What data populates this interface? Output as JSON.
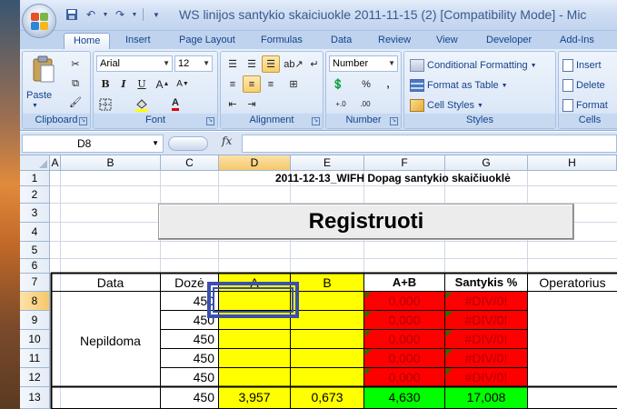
{
  "window": {
    "title": "WS linijos santykio skaiciuokle 2011-11-15 (2)  [Compatibility Mode] - Mic"
  },
  "tabs": [
    "Home",
    "Insert",
    "Page Layout",
    "Formulas",
    "Data",
    "Review",
    "View",
    "Developer",
    "Add-Ins"
  ],
  "ribbon": {
    "clipboard": {
      "label": "Clipboard",
      "paste": "Paste"
    },
    "font": {
      "label": "Font",
      "name": "Arial",
      "size": "12"
    },
    "alignment": {
      "label": "Alignment"
    },
    "number": {
      "label": "Number",
      "format": "Number",
      "percent": "%",
      "comma": ",",
      "dec_inc": "+.0",
      "dec_dec": ".00"
    },
    "styles": {
      "label": "Styles",
      "conditional": "Conditional Formatting",
      "format_table": "Format as Table",
      "cell_styles": "Cell Styles"
    },
    "cells": {
      "label": "Cells",
      "insert": "Insert",
      "delete": "Delete",
      "format": "Format"
    }
  },
  "formula_bar": {
    "name_box": "D8",
    "fx": "fx",
    "content": ""
  },
  "columns": [
    "A",
    "B",
    "C",
    "D",
    "E",
    "F",
    "G",
    "H"
  ],
  "rows": [
    "1",
    "2",
    "3",
    "4",
    "5",
    "6",
    "7",
    "8",
    "9",
    "10",
    "11",
    "12",
    "13"
  ],
  "sheet": {
    "heading": "2011-12-13_WIFH Dopag santykio skaičiuoklė",
    "button": "Registruoti",
    "headers": {
      "data": "Data",
      "doze": "Dozė",
      "a": "A",
      "b": "B",
      "ab": "A+B",
      "santykis": "Santykis %",
      "operatorius": "Operatorius"
    },
    "group_label": "Nepildoma",
    "data_rows": [
      {
        "doze": "450",
        "ab": "0,000",
        "santykis": "#DIV/0!"
      },
      {
        "doze": "450",
        "ab": "0,000",
        "santykis": "#DIV/0!"
      },
      {
        "doze": "450",
        "ab": "0,000",
        "santykis": "#DIV/0!"
      },
      {
        "doze": "450",
        "ab": "0,000",
        "santykis": "#DIV/0!"
      },
      {
        "doze": "450",
        "ab": "0,000",
        "santykis": "#DIV/0!"
      }
    ],
    "row13": {
      "doze": "450",
      "a": "3,957",
      "b": "0,673",
      "ab": "4,630",
      "santykis": "17,008"
    }
  }
}
